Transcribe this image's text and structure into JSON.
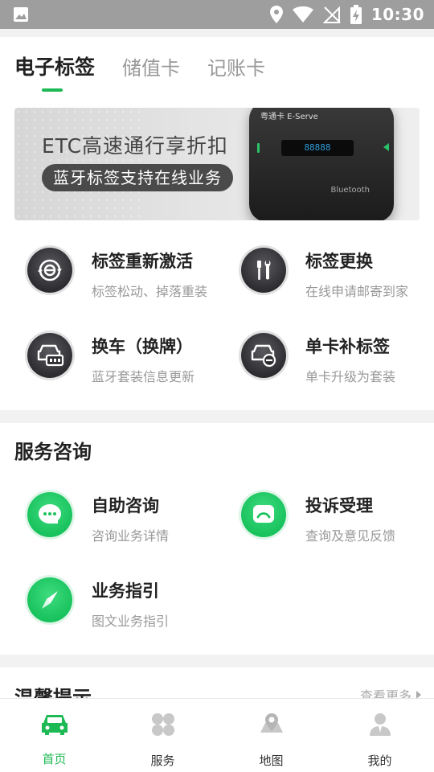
{
  "status_bar": {
    "time": "10:30"
  },
  "tabs": [
    {
      "label": "电子标签",
      "active": true
    },
    {
      "label": "储值卡",
      "active": false
    },
    {
      "label": "记账卡",
      "active": false
    }
  ],
  "banner": {
    "headline": "ETC高速通行享折扣",
    "pill": "蓝牙标签支持在线业务",
    "device_brand": "粤通卡 E-Serve",
    "device_display": "88888",
    "device_bt": "Bluetooth"
  },
  "tag_services": [
    {
      "title": "标签重新激活",
      "sub": "标签松动、掉落重装",
      "icon": "reactivate-icon"
    },
    {
      "title": "标签更换",
      "sub": "在线申请邮寄到家",
      "icon": "tools-icon"
    },
    {
      "title": "换车（换牌）",
      "sub": "蓝牙套装信息更新",
      "icon": "car-plate-icon"
    },
    {
      "title": "单卡补标签",
      "sub": "单卡升级为套装",
      "icon": "car-add-icon"
    }
  ],
  "consult": {
    "title": "服务咨询",
    "items": [
      {
        "title": "自助咨询",
        "sub": "咨询业务详情",
        "icon": "chat-icon"
      },
      {
        "title": "投诉受理",
        "sub": "查询及意见反馈",
        "icon": "complaint-icon"
      },
      {
        "title": "业务指引",
        "sub": "图文业务指引",
        "icon": "compass-icon"
      }
    ]
  },
  "tips": {
    "title": "温馨提示",
    "more": "查看更多"
  },
  "bottom_nav": [
    {
      "label": "首页",
      "icon": "car-icon",
      "active": true
    },
    {
      "label": "服务",
      "icon": "grid-icon",
      "active": false
    },
    {
      "label": "地图",
      "icon": "map-icon",
      "active": false
    },
    {
      "label": "我的",
      "icon": "user-icon",
      "active": false
    }
  ],
  "colors": {
    "accent": "#1db954",
    "icon_dark": "#2d2d31",
    "status_bar": "#9e9e9e"
  }
}
